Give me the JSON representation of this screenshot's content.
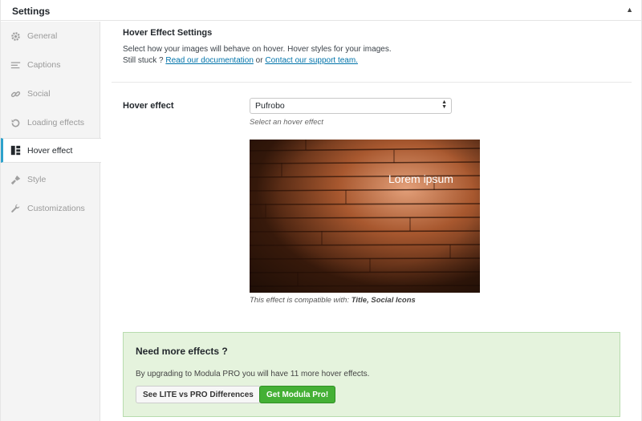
{
  "header": {
    "title": "Settings",
    "toggle_icon": "▲"
  },
  "sidebar": {
    "items": [
      {
        "label": "General",
        "icon": "gear-icon"
      },
      {
        "label": "Captions",
        "icon": "lines-icon"
      },
      {
        "label": "Social",
        "icon": "link-icon"
      },
      {
        "label": "Loading effects",
        "icon": "refresh-icon"
      },
      {
        "label": "Hover effect",
        "icon": "layout-icon",
        "active": true
      },
      {
        "label": "Style",
        "icon": "brush-icon"
      },
      {
        "label": "Customizations",
        "icon": "wrench-icon"
      }
    ]
  },
  "section": {
    "title": "Hover Effect Settings",
    "desc_line1": "Select how your images will behave on hover. Hover styles for your images.",
    "desc_prefix": "Still stuck ? ",
    "doc_link": "Read our documentation",
    "desc_or": " or ",
    "support_link": "Contact our support team."
  },
  "field": {
    "label": "Hover effect",
    "selected": "Pufrobo",
    "hint": "Select an hover effect"
  },
  "preview": {
    "caption": "Lorem ipsum",
    "compat_prefix": "This effect is compatible with: ",
    "compat_items": "Title, Social Icons"
  },
  "upsell": {
    "title": "Need more effects ?",
    "text": "By upgrading to Modula PRO you will have 11 more hover effects.",
    "compare_label": "See LITE vs PRO Differences",
    "cta_label": "Get Modula Pro!"
  },
  "colors": {
    "accent": "#2ea2cc",
    "link": "#0073aa",
    "cta": "#44b035",
    "upsell_bg": "#e5f3dd"
  }
}
